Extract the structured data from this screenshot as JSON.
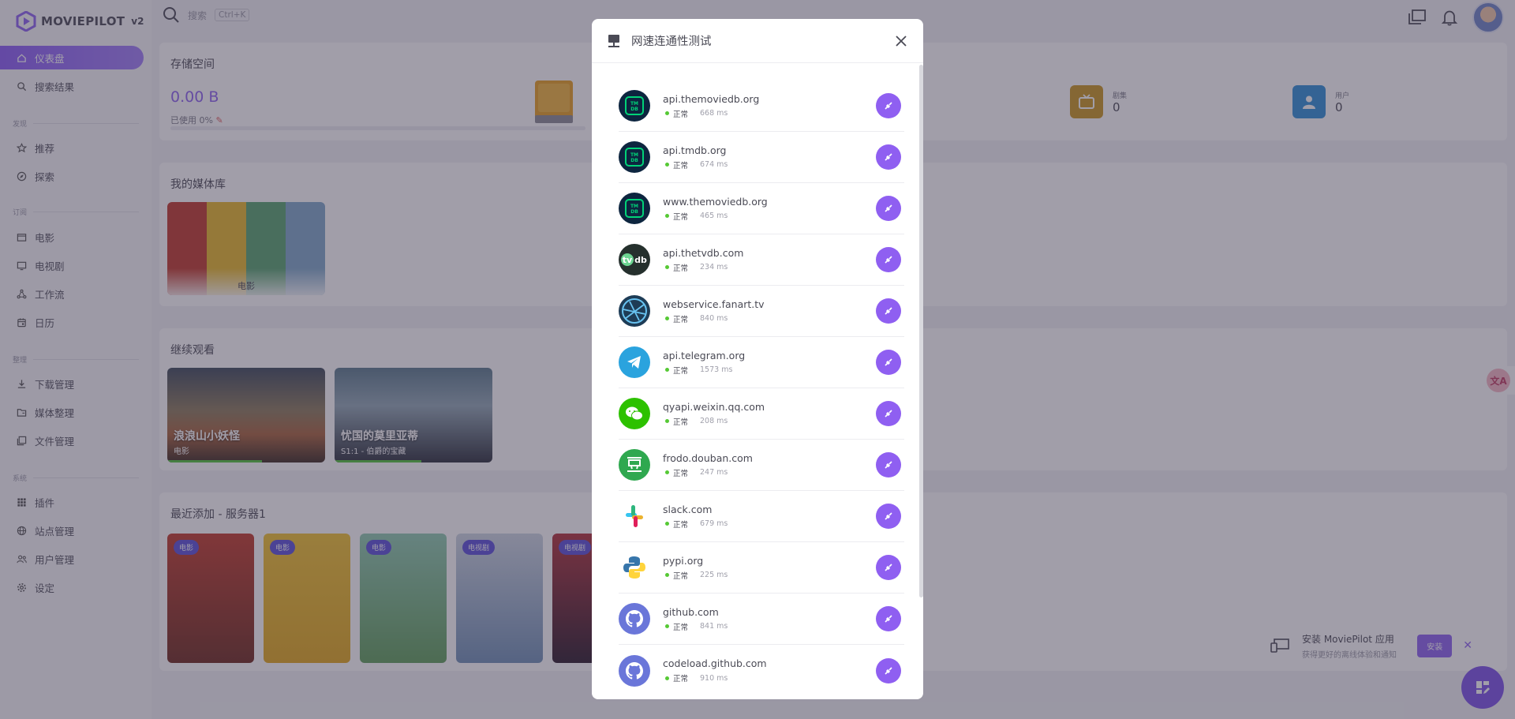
{
  "app": {
    "name": "MOVIEPILOT",
    "version": "v2"
  },
  "search": {
    "placeholder": "搜索",
    "shortcut": "Ctrl+K"
  },
  "sidebar": {
    "items": [
      {
        "label": "仪表盘",
        "icon": "home-icon",
        "active": true
      },
      {
        "label": "搜索结果",
        "icon": "search-icon"
      },
      {
        "label": "推荐",
        "icon": "star-icon"
      },
      {
        "label": "探索",
        "icon": "compass-icon"
      },
      {
        "label": "电影",
        "icon": "movie-icon"
      },
      {
        "label": "电视剧",
        "icon": "tv-icon"
      },
      {
        "label": "工作流",
        "icon": "workflow-icon"
      },
      {
        "label": "日历",
        "icon": "calendar-icon"
      },
      {
        "label": "下载管理",
        "icon": "download-icon"
      },
      {
        "label": "媒体整理",
        "icon": "organize-icon"
      },
      {
        "label": "文件管理",
        "icon": "files-icon"
      },
      {
        "label": "插件",
        "icon": "grid-icon"
      },
      {
        "label": "站点管理",
        "icon": "globe-icon"
      },
      {
        "label": "用户管理",
        "icon": "users-icon"
      },
      {
        "label": "设定",
        "icon": "gear-icon"
      }
    ],
    "sections": [
      "发现",
      "订阅",
      "整理",
      "系统"
    ]
  },
  "dashboard": {
    "storage": {
      "title": "存储空间",
      "value": "0.00 B",
      "used": "已使用 0%"
    },
    "stats": [
      {
        "label": "剧集",
        "value": "0",
        "color": "#c9961f"
      },
      {
        "label": "用户",
        "value": "0",
        "color": "#2f8fd6"
      }
    ],
    "library": {
      "title": "我的媒体库",
      "item_label": "电影"
    },
    "continue": {
      "title": "继续观看",
      "items": [
        {
          "title": "浪浪山小妖怪",
          "sub": "电影",
          "progress": 0.6
        },
        {
          "title": "忧国的莫里亚蒂",
          "sub": "S1:1 - 伯爵的宝藏",
          "progress": 0.55
        }
      ]
    },
    "recent": {
      "title": "最近添加 - 服务器1",
      "badges": [
        "电影",
        "电影",
        "电影",
        "电视剧",
        "电视剧"
      ]
    }
  },
  "install": {
    "title": "安装 MoviePilot 应用",
    "sub": "获得更好的离线体验和通知",
    "button": "安装"
  },
  "modal": {
    "title": "网速连通性测试",
    "rows": [
      {
        "host": "api.themoviedb.org",
        "status": "正常",
        "time": "668 ms",
        "logo": "tmdb"
      },
      {
        "host": "api.tmdb.org",
        "status": "正常",
        "time": "674 ms",
        "logo": "tmdb"
      },
      {
        "host": "www.themoviedb.org",
        "status": "正常",
        "time": "465 ms",
        "logo": "tmdb"
      },
      {
        "host": "api.thetvdb.com",
        "status": "正常",
        "time": "234 ms",
        "logo": "tvdb"
      },
      {
        "host": "webservice.fanart.tv",
        "status": "正常",
        "time": "840 ms",
        "logo": "fanart"
      },
      {
        "host": "api.telegram.org",
        "status": "正常",
        "time": "1573 ms",
        "logo": "telegram"
      },
      {
        "host": "qyapi.weixin.qq.com",
        "status": "正常",
        "time": "208 ms",
        "logo": "wechat"
      },
      {
        "host": "frodo.douban.com",
        "status": "正常",
        "time": "247 ms",
        "logo": "douban"
      },
      {
        "host": "slack.com",
        "status": "正常",
        "time": "679 ms",
        "logo": "slack"
      },
      {
        "host": "pypi.org",
        "status": "正常",
        "time": "225 ms",
        "logo": "python"
      },
      {
        "host": "github.com",
        "status": "正常",
        "time": "841 ms",
        "logo": "github"
      },
      {
        "host": "codeload.github.com",
        "status": "正常",
        "time": "910 ms",
        "logo": "github"
      }
    ]
  }
}
